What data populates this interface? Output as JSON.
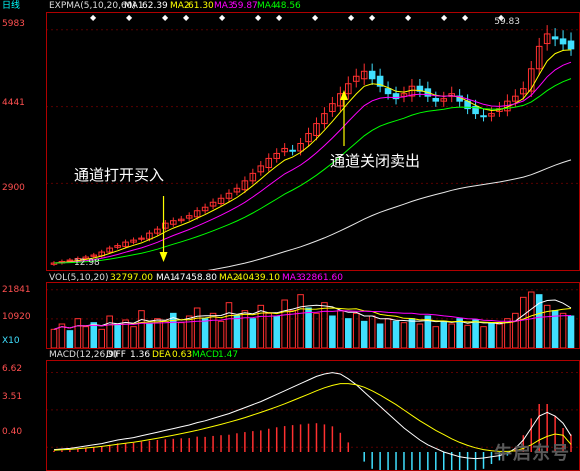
{
  "header": {
    "period_label": "日线",
    "indicator": "EXPMA(5,10,20,60)",
    "ma1_label": "MA1",
    "ma1_value": "62.39",
    "ma2_label": "MA2",
    "ma2_value": "61.30",
    "ma3_label": "MA3",
    "ma3_value": "59.87",
    "ma4_label": "MA4",
    "ma4_value": "48.56",
    "high_label": "59.83"
  },
  "annotations": {
    "open_buy": "通道打开买入",
    "close_sell": "通道关闭卖出",
    "low_price": "12.98"
  },
  "volume_header": {
    "indicator": "VOL(5,10,20)",
    "vol_value": "32797.00",
    "ma1_label": "MA1",
    "ma1_value": "47458.80",
    "ma2_label": "MA2",
    "ma2_value": "40439.10",
    "ma3_label": "MA3",
    "ma3_value": "32861.60",
    "unit": "X10"
  },
  "macd_header": {
    "indicator": "MACD(12,26,9)",
    "diff_label": "DIFF",
    "diff_value": "1.36",
    "dea_label": "DEA",
    "dea_value": "0.63",
    "macd_label": "MACD",
    "macd_value": "1.47"
  },
  "watermark": "牛启东号",
  "colors": {
    "up": "#ff3030",
    "down": "#40e0ff",
    "ma1": "#ffffff",
    "ma2": "#ffff00",
    "ma3": "#ff00ff",
    "ma4": "#00ff00",
    "axis": "#ff5050"
  },
  "chart_data": [
    {
      "type": "candlestick",
      "title": "",
      "ylim": [
        1200,
        6300
      ],
      "yticks": [
        "5983",
        "4441",
        "2900"
      ],
      "y_tick_values": [
        5983,
        4441,
        2900
      ],
      "close_index": [
        1300,
        1330,
        1360,
        1390,
        1420,
        1460,
        1520,
        1600,
        1650,
        1720,
        1760,
        1800,
        1900,
        1980,
        2100,
        2150,
        2180,
        2250,
        2350,
        2420,
        2520,
        2600,
        2700,
        2800,
        2950,
        3100,
        3250,
        3400,
        3500,
        3600,
        3550,
        3700,
        3900,
        4100,
        4300,
        4500,
        4700,
        4900,
        5050,
        5150,
        5000,
        4850,
        4700,
        4600,
        4700,
        4850,
        4750,
        4650,
        4550,
        4600,
        4700,
        4550,
        4400,
        4300,
        4250,
        4300,
        4400,
        4550,
        4650,
        4800,
        5200,
        5650,
        5900,
        5800,
        5700,
        5600
      ],
      "markers": {
        "open_buy_index": 10,
        "close_sell_index": 42
      }
    },
    {
      "type": "bar",
      "title": "",
      "yticks": [
        "21841",
        "10920"
      ],
      "y_tick_values": [
        21841,
        10920
      ],
      "ylim": [
        0,
        24000
      ],
      "values": [
        7000,
        9000,
        6500,
        11000,
        8000,
        9500,
        7000,
        12000,
        9000,
        10500,
        8000,
        14000,
        9000,
        11000,
        10000,
        13000,
        9500,
        12000,
        15000,
        11000,
        13000,
        10000,
        17000,
        12000,
        14000,
        11000,
        16000,
        13000,
        12000,
        18000,
        14000,
        20000,
        15000,
        13000,
        17000,
        12000,
        14000,
        11000,
        13000,
        10000,
        12000,
        9000,
        11000,
        10000,
        9500,
        11000,
        9000,
        12000,
        8000,
        10000,
        9000,
        11000,
        8500,
        10500,
        8000,
        9500,
        9000,
        11000,
        13000,
        19000,
        21000,
        20000,
        16000,
        14000,
        13000,
        12000
      ],
      "up": [
        true,
        true,
        false,
        true,
        true,
        false,
        true,
        true,
        false,
        true,
        true,
        true,
        false,
        true,
        true,
        false,
        true,
        true,
        true,
        false,
        true,
        true,
        true,
        false,
        true,
        false,
        true,
        true,
        false,
        true,
        true,
        true,
        false,
        true,
        true,
        false,
        true,
        false,
        true,
        false,
        true,
        false,
        true,
        false,
        true,
        false,
        true,
        false,
        true,
        false,
        true,
        false,
        true,
        false,
        true,
        false,
        true,
        true,
        true,
        true,
        true,
        false,
        true,
        false,
        true,
        false
      ]
    },
    {
      "type": "line",
      "title": "",
      "yticks": [
        "6.62",
        "3.51",
        "0.40"
      ],
      "y_tick_values": [
        6.62,
        3.51,
        0.4
      ],
      "ylim": [
        -1.5,
        7.5
      ],
      "diff": [
        0.2,
        0.25,
        0.3,
        0.4,
        0.5,
        0.6,
        0.7,
        0.85,
        1.0,
        1.1,
        1.2,
        1.35,
        1.5,
        1.65,
        1.8,
        1.95,
        2.1,
        2.25,
        2.45,
        2.6,
        2.8,
        3.0,
        3.2,
        3.45,
        3.7,
        3.95,
        4.2,
        4.5,
        4.8,
        5.1,
        5.4,
        5.7,
        6.0,
        6.3,
        6.5,
        6.62,
        6.5,
        6.1,
        5.6,
        5.0,
        4.4,
        3.8,
        3.2,
        2.6,
        2.0,
        1.5,
        1.0,
        0.6,
        0.3,
        0.0,
        -0.2,
        -0.4,
        -0.5,
        -0.55,
        -0.5,
        -0.4,
        -0.3,
        -0.1,
        0.3,
        1.0,
        2.0,
        3.0,
        3.3,
        3.0,
        2.4,
        1.36
      ],
      "dea": [
        0.15,
        0.18,
        0.22,
        0.27,
        0.33,
        0.4,
        0.47,
        0.55,
        0.64,
        0.73,
        0.82,
        0.92,
        1.03,
        1.15,
        1.27,
        1.4,
        1.53,
        1.67,
        1.81,
        1.97,
        2.13,
        2.3,
        2.48,
        2.67,
        2.87,
        3.08,
        3.3,
        3.53,
        3.77,
        4.02,
        4.28,
        4.55,
        4.82,
        5.1,
        5.35,
        5.55,
        5.7,
        5.7,
        5.6,
        5.4,
        5.1,
        4.75,
        4.35,
        3.95,
        3.5,
        3.05,
        2.6,
        2.2,
        1.8,
        1.45,
        1.1,
        0.8,
        0.55,
        0.35,
        0.2,
        0.1,
        0.05,
        0.05,
        0.1,
        0.3,
        0.6,
        1.0,
        1.3,
        1.5,
        1.4,
        0.63
      ]
    }
  ]
}
